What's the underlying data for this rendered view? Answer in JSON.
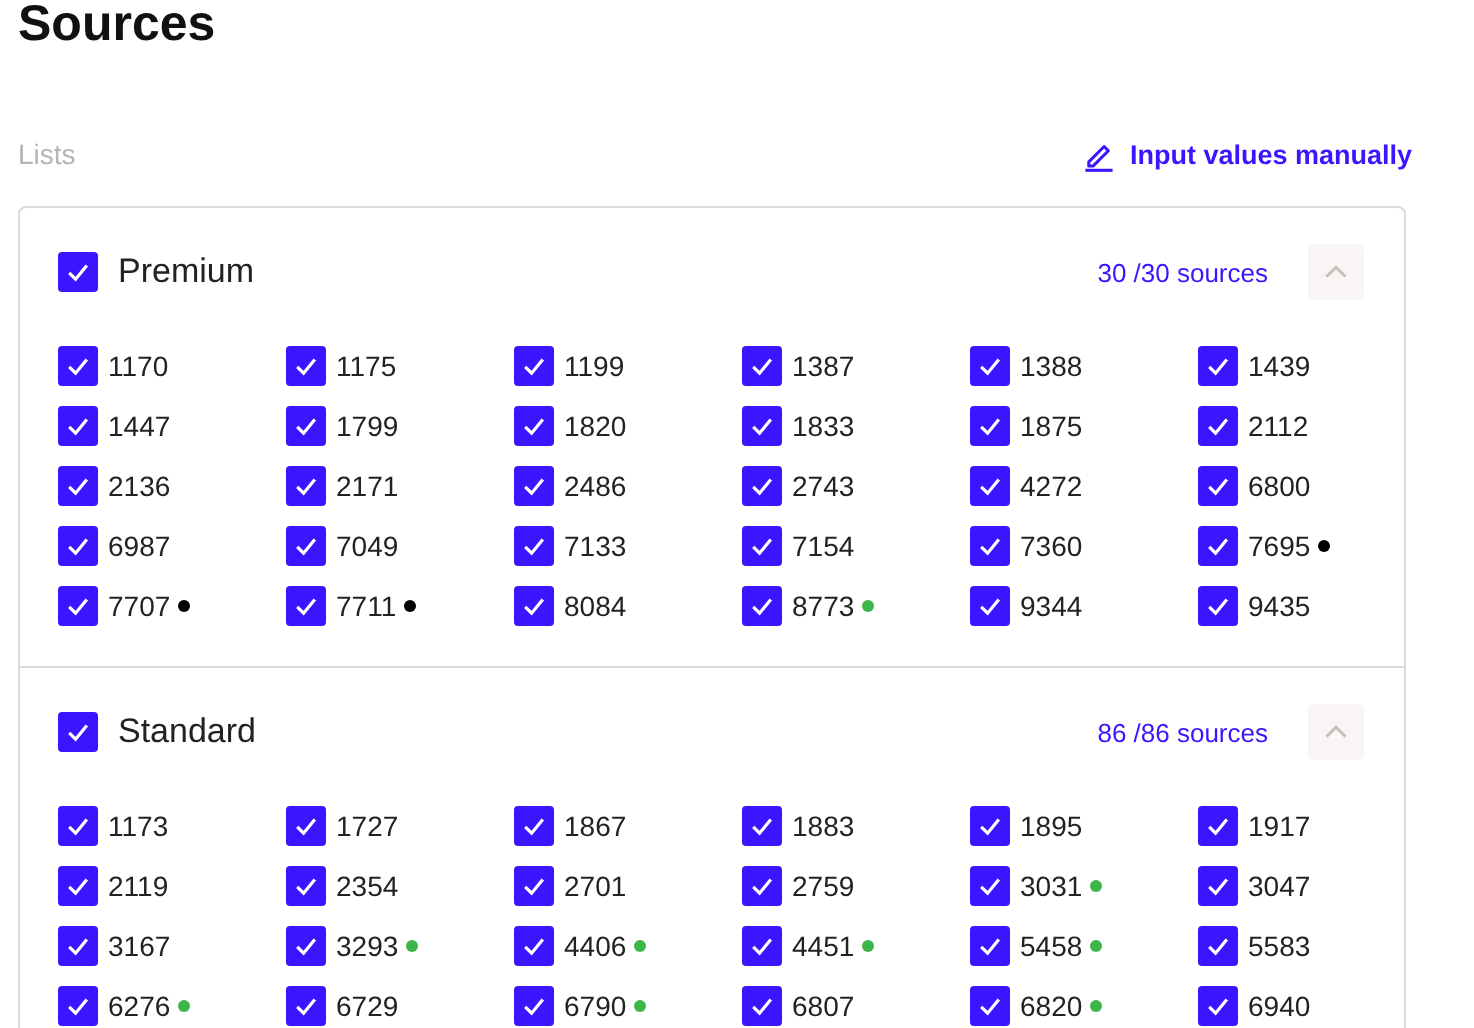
{
  "title": "Sources",
  "lists_label": "Lists",
  "manual_link": "Input values manually",
  "sections": [
    {
      "name": "Premium",
      "checked": true,
      "count": "30 /30  sources",
      "expanded": true,
      "items": [
        {
          "label": "1170",
          "checked": true
        },
        {
          "label": "1175",
          "checked": true
        },
        {
          "label": "1199",
          "checked": true
        },
        {
          "label": "1387",
          "checked": true
        },
        {
          "label": "1388",
          "checked": true
        },
        {
          "label": "1439",
          "checked": true
        },
        {
          "label": "1447",
          "checked": true
        },
        {
          "label": "1799",
          "checked": true
        },
        {
          "label": "1820",
          "checked": true
        },
        {
          "label": "1833",
          "checked": true
        },
        {
          "label": "1875",
          "checked": true
        },
        {
          "label": "2112",
          "checked": true
        },
        {
          "label": "2136",
          "checked": true
        },
        {
          "label": "2171",
          "checked": true
        },
        {
          "label": "2486",
          "checked": true
        },
        {
          "label": "2743",
          "checked": true
        },
        {
          "label": "4272",
          "checked": true
        },
        {
          "label": "6800",
          "checked": true
        },
        {
          "label": "6987",
          "checked": true
        },
        {
          "label": "7049",
          "checked": true
        },
        {
          "label": "7133",
          "checked": true
        },
        {
          "label": "7154",
          "checked": true
        },
        {
          "label": "7360",
          "checked": true
        },
        {
          "label": "7695",
          "checked": true,
          "color": "#000000"
        },
        {
          "label": "7707",
          "checked": true,
          "color": "#000000"
        },
        {
          "label": "7711",
          "checked": true,
          "color": "#000000"
        },
        {
          "label": "8084",
          "checked": true
        },
        {
          "label": "8773",
          "checked": true,
          "color": "#3cb54a"
        },
        {
          "label": "9344",
          "checked": true
        },
        {
          "label": "9435",
          "checked": true
        }
      ]
    },
    {
      "name": "Standard",
      "checked": true,
      "count": "86 /86 sources",
      "expanded": true,
      "items": [
        {
          "label": "1173",
          "checked": true
        },
        {
          "label": "1727",
          "checked": true
        },
        {
          "label": "1867",
          "checked": true
        },
        {
          "label": "1883",
          "checked": true
        },
        {
          "label": "1895",
          "checked": true
        },
        {
          "label": "1917",
          "checked": true
        },
        {
          "label": "2119",
          "checked": true
        },
        {
          "label": "2354",
          "checked": true
        },
        {
          "label": "2701",
          "checked": true
        },
        {
          "label": "2759",
          "checked": true
        },
        {
          "label": "3031",
          "checked": true,
          "color": "#3cb54a"
        },
        {
          "label": "3047",
          "checked": true
        },
        {
          "label": "3167",
          "checked": true
        },
        {
          "label": "3293",
          "checked": true,
          "color": "#3cb54a"
        },
        {
          "label": "4406",
          "checked": true,
          "color": "#3cb54a"
        },
        {
          "label": "4451",
          "checked": true,
          "color": "#3cb54a"
        },
        {
          "label": "5458",
          "checked": true,
          "color": "#3cb54a"
        },
        {
          "label": "5583",
          "checked": true
        },
        {
          "label": "6276",
          "checked": true,
          "color": "#3cb54a"
        },
        {
          "label": "6729",
          "checked": true
        },
        {
          "label": "6790",
          "checked": true,
          "color": "#3cb54a"
        },
        {
          "label": "6807",
          "checked": true
        },
        {
          "label": "6820",
          "checked": true,
          "color": "#3cb54a"
        },
        {
          "label": "6940",
          "checked": true
        }
      ]
    }
  ]
}
